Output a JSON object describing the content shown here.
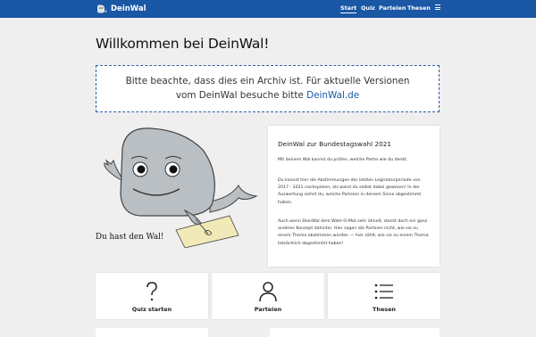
{
  "navbar": {
    "brand": "DeinWal",
    "links": [
      "Start",
      "Quiz",
      "Parteien",
      "Thesen"
    ],
    "active": "Start",
    "menu_icon": "hamburger-icon"
  },
  "title": "Willkommen bei DeinWal!",
  "archive": {
    "line1": "Bitte beachte, dass dies ein Archiv ist. Für aktuelle Versionen",
    "line2_prefix": "vom DeinWal besuche bitte ",
    "link_text": "DeinWal.de"
  },
  "whale": {
    "caption": "Du hast den Wal!",
    "image": "whale-mascot-illustration"
  },
  "info": {
    "title": "DeinWal zur Bundestagswahl 2021",
    "p1": "Mit deinem Wal kannst du prüfen, welche Partei wie du denkt.",
    "p2": "Du kannst hier die Abstimmungen der letzten Legislaturperiode von 2017 - 2021 nachspielen, als warst du selbst dabei gewesen! In der Auswertung siehst du, welche Parteien in deinem Sinne abgestimmt haben.",
    "p3": "Auch wenn DeinWal dem Wahl-O-Mat sehr ähnelt, steckt doch ein ganz anderes Konzept dahinter. Hier sagen die Parteien nicht, wie sie zu einem Thema abstimmen würden — hier zählt, wie sie zu einem Thema tatsächlich abgestimmt haben!"
  },
  "actions": [
    {
      "label": "Quiz starten",
      "icon": "question-mark-icon"
    },
    {
      "label": "Parteien",
      "icon": "person-icon"
    },
    {
      "label": "Thesen",
      "icon": "list-icon"
    }
  ],
  "colors": {
    "brand": "#1a57a5",
    "background": "#efefef",
    "whale": "#b9bfc3"
  }
}
